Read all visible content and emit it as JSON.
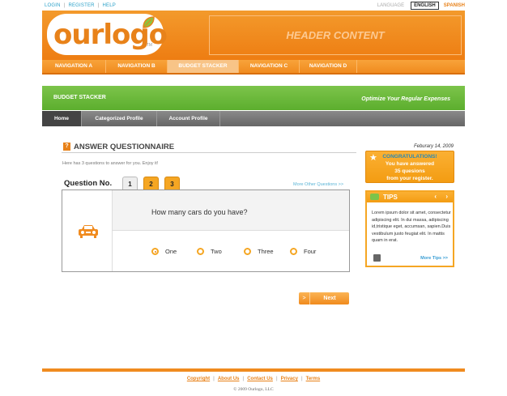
{
  "util": {
    "login": "LOGIN",
    "register": "REGISTER",
    "help": "HELP",
    "language_label": "LANGUAGE",
    "english": "ENGLISH",
    "spanish": "SPANISH"
  },
  "header": {
    "logo_text": "ourlogo",
    "logo_tm": "TM",
    "header_content": "HEADER CONTENT"
  },
  "nav": {
    "items": [
      "NAVIGATION A",
      "NAVIGATION B",
      "BUDGET STACKER",
      "NAVIGATION C",
      "NAVIGATION D"
    ],
    "active": 2
  },
  "budget": {
    "title": "BUDGET STACKER",
    "slogan": "Optimize Your Regular Expenses"
  },
  "subnav": {
    "items": [
      "Home",
      "Categorized Profile",
      "Account Profile"
    ],
    "active": 0
  },
  "main": {
    "date": "Feburary 14, 2009",
    "section_title": "ANSWER QUESTIONNAIRE",
    "section_icon": "?",
    "subtitle": "Here has 3 questions to answer for you. Enjoy it!",
    "question_no_label": "Question No.",
    "tabs": [
      "1",
      "2",
      "3"
    ],
    "more_questions": "More Other Questions  >>",
    "question": "How many cars do you have?",
    "options": [
      "One",
      "Two",
      "Three",
      "Four"
    ],
    "selected_option": 0,
    "next_arrow": ">",
    "next_label": "Next"
  },
  "congrats": {
    "title": "CONGRATULATIONS!",
    "line1": "You have answered",
    "line2": "35 quesions",
    "line3": "from your register."
  },
  "tips": {
    "title": "TIPS",
    "prev": "‹",
    "next": "›",
    "body": "Lorem ipsum dolor sit amet, consectetur adipiscing elit. In dui massa, adipiscing id,tristique eget, accumsan, sapien.Duis vestibulum justo feugiat elit. In mattis quam in erat.",
    "more": "More Tips >>"
  },
  "footer": {
    "links": [
      "Copyright",
      "About Us",
      "Contact Us",
      "Privacy",
      "Terms"
    ],
    "copyright": "© 2009 Ourlogo, LLC"
  },
  "colors": {
    "orange": "#f08b1f",
    "green": "#6cb93c",
    "blue_link": "#2aa0c8"
  }
}
